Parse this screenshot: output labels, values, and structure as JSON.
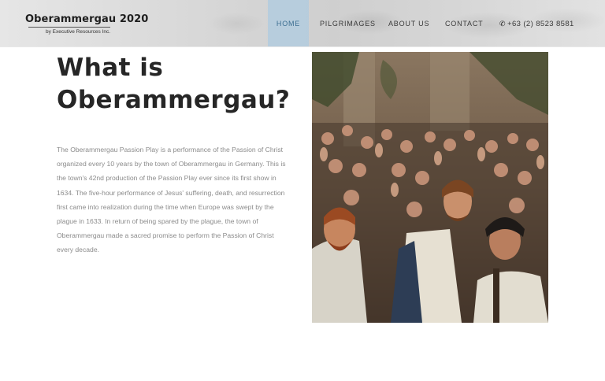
{
  "header": {
    "logo": {
      "title": "Oberammergau 2020",
      "subtitle": "by Executive Resources Inc."
    },
    "nav": {
      "home": "HOME",
      "pilgrimages": "PILGRIMAGES",
      "about": "ABOUT US",
      "contact": "CONTACT",
      "phone": "+63 (2) 8523 8581"
    },
    "phone_icon": "phone-icon",
    "active_color": "#adcbe0"
  },
  "main": {
    "heading": "What is Oberammergau?",
    "paragraph": "The Oberammergau Passion Play is a performance of the Passion of Christ organized every 10 years by the town of Oberammergau in Germany. This is the town's 42nd production of the Passion Play ever since its first show in 1634. The five-hour performance of Jesus' suffering, death, and resurrection first came into realization during the time when Europe was swept by the plague in 1633. In return of being spared by the plague, the town of Oberammergau made a sacred promise to perform the Passion of Christ every decade."
  }
}
